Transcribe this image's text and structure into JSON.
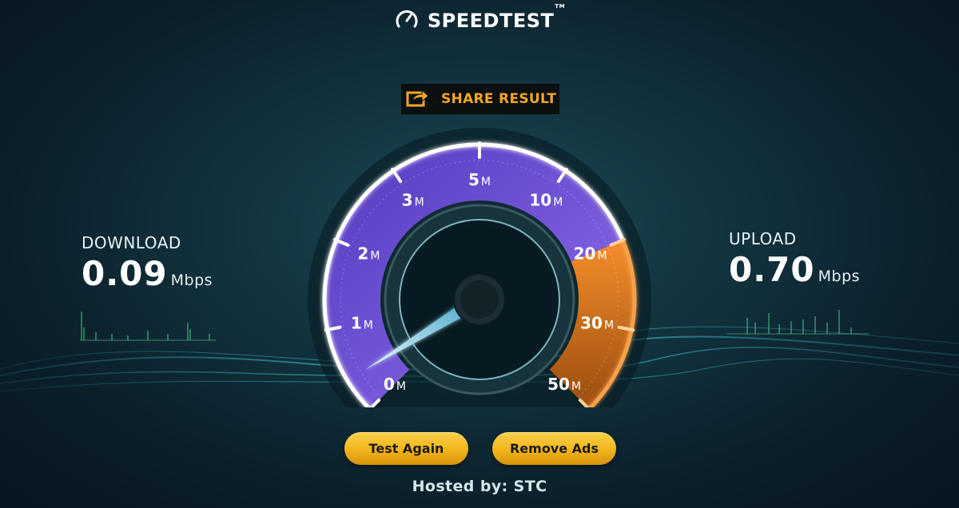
{
  "app": {
    "title": "SPEEDTEST",
    "trademark": "TM"
  },
  "share": {
    "label": "SHARE RESULT"
  },
  "download": {
    "label": "DOWNLOAD",
    "value": "0.09",
    "unit": "Mbps"
  },
  "upload": {
    "label": "UPLOAD",
    "value": "0.70",
    "unit": "Mbps"
  },
  "gauge": {
    "ticks": [
      {
        "num": "0",
        "unit": "M"
      },
      {
        "num": "1",
        "unit": "M"
      },
      {
        "num": "2",
        "unit": "M"
      },
      {
        "num": "3",
        "unit": "M"
      },
      {
        "num": "5",
        "unit": "M"
      },
      {
        "num": "10",
        "unit": "M"
      },
      {
        "num": "20",
        "unit": "M"
      },
      {
        "num": "30",
        "unit": "M"
      },
      {
        "num": "50",
        "unit": "M"
      }
    ],
    "needle_fraction": 0.02,
    "colors": {
      "purple": "#6a4fd8",
      "orange": "#f08a2a",
      "accent": "#f5a623"
    }
  },
  "buttons": {
    "test_again": "Test Again",
    "remove_ads": "Remove Ads"
  },
  "hosted": {
    "text": "Hosted by: STC"
  }
}
